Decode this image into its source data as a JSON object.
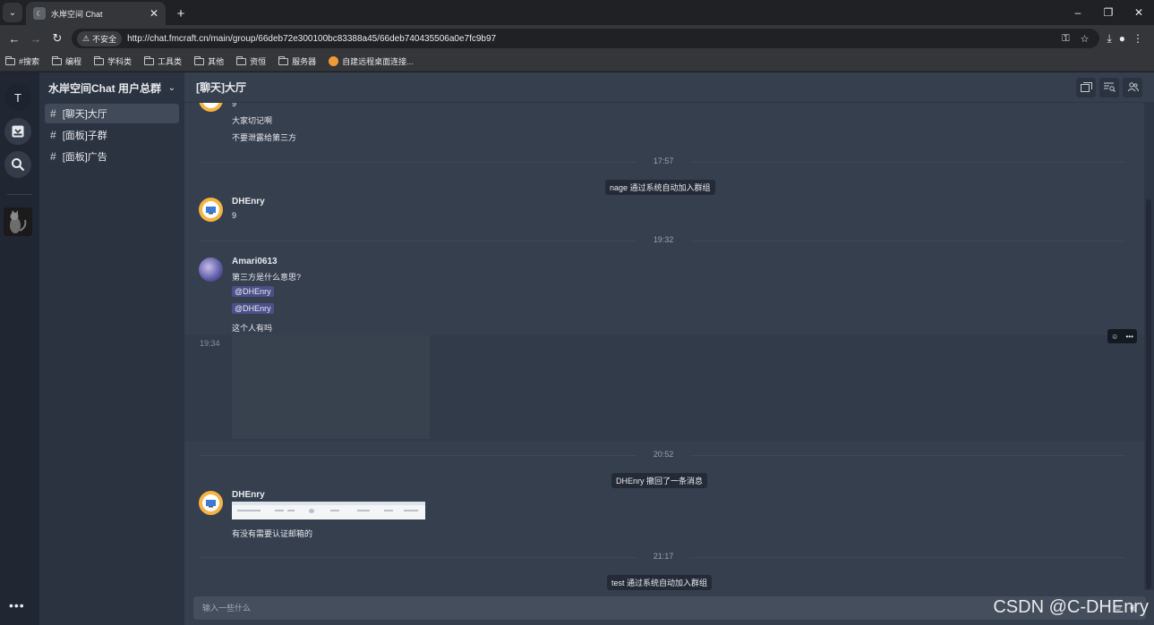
{
  "browser": {
    "tab_title": "水岸空间 Chat",
    "tab_close": "✕",
    "new_tab": "+",
    "win_min": "–",
    "win_restore": "❐",
    "win_close": "✕",
    "insecure_label": "不安全",
    "url": "http://chat.fmcraft.cn/main/group/66deb72e300100bc83388a45/66deb740435506a0e7fc9b97",
    "bookmarks": [
      {
        "label": "#搜索",
        "icon": "folder"
      },
      {
        "label": "编程",
        "icon": "folder"
      },
      {
        "label": "学科类",
        "icon": "folder"
      },
      {
        "label": "工具类",
        "icon": "folder"
      },
      {
        "label": "其他",
        "icon": "folder"
      },
      {
        "label": "资恒",
        "icon": "folder"
      },
      {
        "label": "服务器",
        "icon": "folder"
      },
      {
        "label": "自建远程桌面连接...",
        "icon": "site-favicon"
      }
    ]
  },
  "rail": {
    "avatar_letter": "T",
    "more": "•••"
  },
  "sidebar": {
    "group_title": "水岸空间Chat 用户总群",
    "channels": [
      {
        "label": "[聊天]大厅",
        "active": true
      },
      {
        "label": "[面板]子群",
        "active": false
      },
      {
        "label": "[面板]广告",
        "active": false
      }
    ]
  },
  "main": {
    "title": "[聊天]大厅",
    "messages": {
      "top_partial": "9",
      "line_a": "大家切记啊",
      "line_b": "不要泄露给第三方",
      "time_1": "17:57",
      "sys_1": "nage 通过系统自动加入群组",
      "dh_name_1": "DHEnry",
      "dh_text_1": "9",
      "time_2": "19:32",
      "am_name": "Amari0613",
      "am_text_1": "第三方是什么意思?",
      "mention_1": "@DHEnry",
      "mention_2": "@DHEnry",
      "am_text_2": "这个人有吗",
      "hover_time": "19:34",
      "time_3": "20:52",
      "sys_2": "DHEnry 撤回了一条消息",
      "dh_name_2": "DHEnry",
      "dh_text_2": "有没有需要认证邮箱的",
      "time_4": "21:17",
      "sys_3": "test 通过系统自动加入群组"
    },
    "input_placeholder": "输入一些什么"
  },
  "watermark": "CSDN @C-DHEnry",
  "colors": {
    "rail_bg": "#202733",
    "sidebar_bg": "#2b3341",
    "main_bg": "#353f4e",
    "active_channel": "#414a58",
    "mention_bg": "#4b4f8a",
    "avatar_ring": "#f5b342"
  }
}
